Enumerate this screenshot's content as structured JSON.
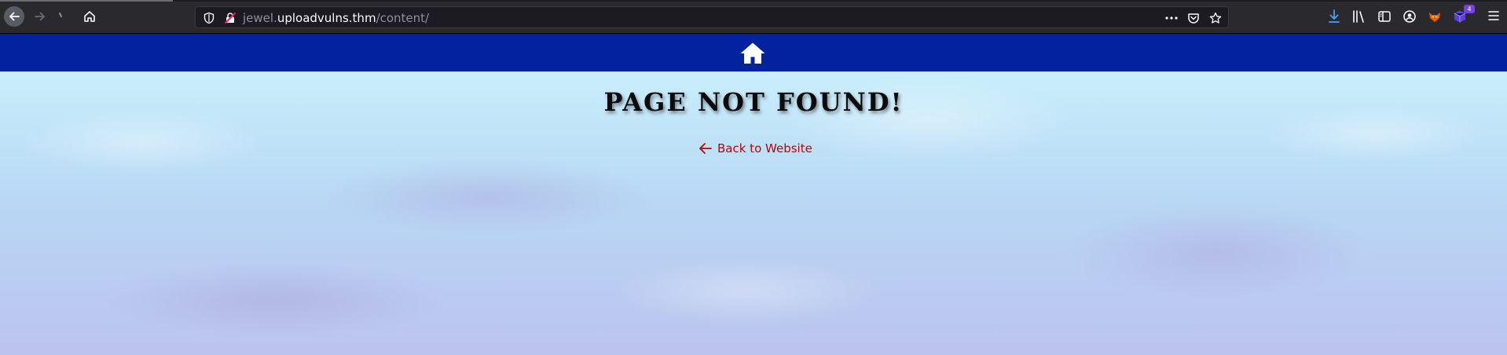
{
  "browser": {
    "url_prefix": "jewel.",
    "url_domain": "uploadvulns.thm",
    "url_path": "/content/",
    "extension_badge": "4",
    "icons": {
      "back": "arrow-left-icon",
      "forward": "arrow-right-icon",
      "reload": "loading-icon",
      "home": "home-icon",
      "tracking": "shield-icon",
      "insecure": "lock-slash-icon",
      "page_actions": "ellipsis-icon",
      "pocket": "pocket-icon",
      "bookmark": "star-icon",
      "downloads": "download-icon",
      "library": "library-icon",
      "sidebar": "sidebar-icon",
      "account": "account-icon",
      "ext1": "fox-extension-icon",
      "ext2": "cube-extension-icon",
      "menu": "hamburger-menu-icon"
    }
  },
  "site": {
    "nav": {
      "home_icon": "home-icon"
    },
    "title": "Page Not Found!",
    "back_link": {
      "label": "Back to Website",
      "icon": "arrow-left-icon"
    },
    "colors": {
      "nav_bg": "#0322a0",
      "link": "#b80505"
    }
  }
}
